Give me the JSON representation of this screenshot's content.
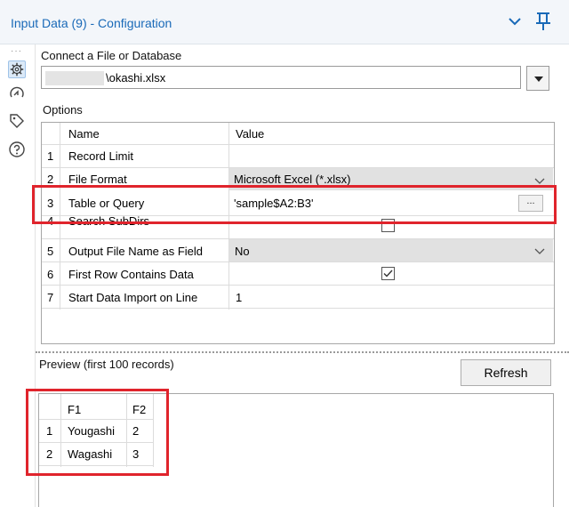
{
  "window": {
    "title": "Input Data (9) - Configuration"
  },
  "connect": {
    "label": "Connect a File or Database",
    "file_value": "\\okashi.xlsx"
  },
  "options": {
    "label": "Options",
    "headers": {
      "name": "Name",
      "value": "Value"
    },
    "rows": [
      {
        "num": "1",
        "name": "Record Limit",
        "value": ""
      },
      {
        "num": "2",
        "name": "File Format",
        "value": "Microsoft Excel (*.xlsx)"
      },
      {
        "num": "3",
        "name": "Table or Query",
        "value": "'sample$A2:B3'",
        "button": "..."
      },
      {
        "num": "4",
        "name": "Search SubDirs",
        "value": "",
        "checked": false
      },
      {
        "num": "5",
        "name": "Output File Name as Field",
        "value": "No"
      },
      {
        "num": "6",
        "name": "First Row Contains Data",
        "value": "",
        "checked": true
      },
      {
        "num": "7",
        "name": "Start Data Import on Line",
        "value": "1"
      }
    ]
  },
  "preview": {
    "label": "Preview (first 100 records)",
    "refresh_label": "Refresh",
    "columns": [
      "F1",
      "F2"
    ],
    "rows": [
      {
        "num": "1",
        "F1": "Yougashi",
        "F2": "2"
      },
      {
        "num": "2",
        "F1": "Wagashi",
        "F2": "3"
      }
    ]
  },
  "colors": {
    "title_blue": "#1a6ab8",
    "highlight_red": "#e0242c",
    "panel_bg": "#f3f6fa"
  },
  "icons": [
    "chevron-down-icon",
    "pin-icon",
    "more-icon",
    "gear-icon",
    "connection-icon",
    "tag-icon",
    "help-icon",
    "dropdown-arrow-icon",
    "checkbox-icon"
  ]
}
